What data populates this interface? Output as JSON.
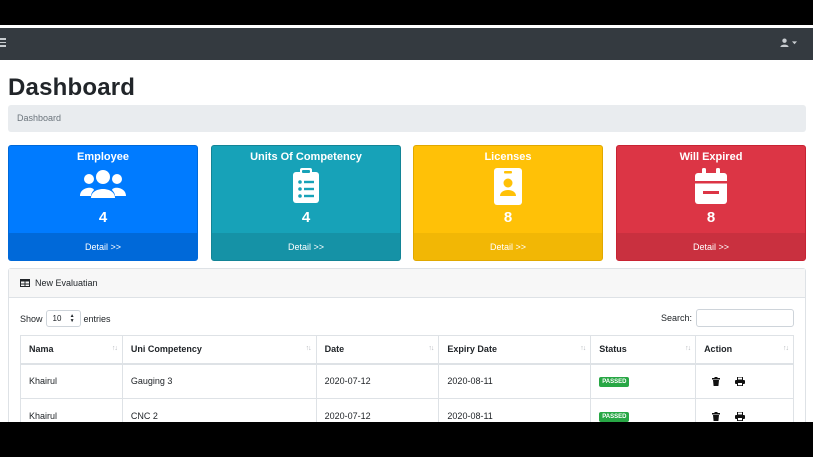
{
  "page": {
    "title": "Dashboard",
    "breadcrumb": "Dashboard"
  },
  "cards": [
    {
      "title": "Employee",
      "count": "4",
      "footer": "Detail >>",
      "icon": "users-icon",
      "color": "#007bff"
    },
    {
      "title": "Units Of Competency",
      "count": "4",
      "footer": "Detail >>",
      "icon": "clipboard-list-icon",
      "color": "#17a2b8"
    },
    {
      "title": "Licenses",
      "count": "8",
      "footer": "Detail >>",
      "icon": "id-badge-icon",
      "color": "#ffc107"
    },
    {
      "title": "Will Expired",
      "count": "8",
      "footer": "Detail >>",
      "icon": "calendar-icon",
      "color": "#dc3545"
    }
  ],
  "panel": {
    "title": "New Evaluatian",
    "show_label": "Show",
    "entries_value": "10",
    "entries_label": "entries",
    "search_label": "Search:"
  },
  "table": {
    "headers": [
      "Nama",
      "Uni Competency",
      "Date",
      "Expiry Date",
      "Status",
      "Action"
    ],
    "rows": [
      {
        "nama": "Khairul",
        "competency": "Gauging 3",
        "date": "2020-07-12",
        "expiry": "2020-08-11",
        "status": "PASSED"
      },
      {
        "nama": "Khairul",
        "competency": "CNC 2",
        "date": "2020-07-12",
        "expiry": "2020-08-11",
        "status": "PASSED"
      }
    ]
  }
}
